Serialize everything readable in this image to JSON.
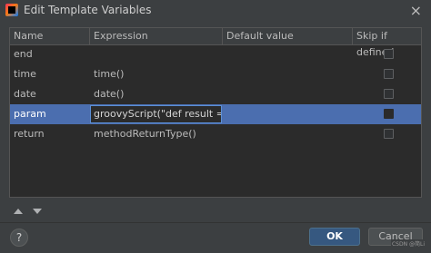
{
  "window": {
    "title": "Edit Template Variables",
    "close_glyph": "×",
    "app_icon": "intellij-icon"
  },
  "table": {
    "columns": [
      "Name",
      "Expression",
      "Default value",
      "Skip if defined"
    ],
    "rows": [
      {
        "name": "end",
        "expression": "",
        "default_value": "",
        "skip_if_defined": false
      },
      {
        "name": "time",
        "expression": "time()",
        "default_value": "",
        "skip_if_defined": false
      },
      {
        "name": "date",
        "expression": "date()",
        "default_value": "",
        "skip_if_defined": false
      },
      {
        "name": "param",
        "expression": "groovyScript(\"def result = '';d...",
        "default_value": "",
        "skip_if_defined": false,
        "selected": true
      },
      {
        "name": "return",
        "expression": "methodReturnType()",
        "default_value": "",
        "skip_if_defined": false
      }
    ]
  },
  "toolbar": {
    "move_up_icon": "move-up-icon",
    "move_down_icon": "move-down-icon"
  },
  "footer": {
    "help_label": "?",
    "ok_label": "OK",
    "cancel_label": "Cancel",
    "watermark": "CSDN @简Li"
  },
  "colors": {
    "selection": "#4b6eaf",
    "primary_button": "#365880"
  }
}
